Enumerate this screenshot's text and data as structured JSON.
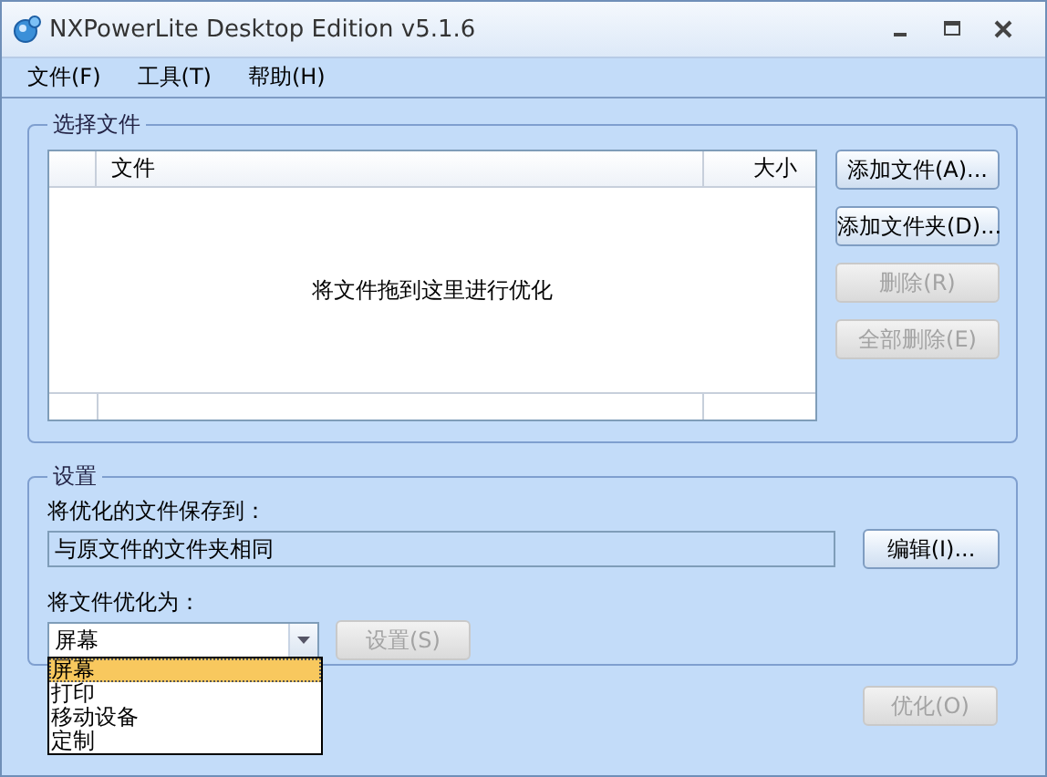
{
  "window": {
    "title": "NXPowerLite Desktop Edition v5.1.6"
  },
  "menu": [
    {
      "label": "文件(F)"
    },
    {
      "label": "工具(T)"
    },
    {
      "label": "帮助(H)"
    }
  ],
  "file_group": {
    "title": "选择文件",
    "table": {
      "columns": [
        "文件",
        "大小"
      ],
      "empty_message": "将文件拖到这里进行优化"
    },
    "buttons": [
      {
        "label": "添加文件(A)...",
        "disabled": false
      },
      {
        "label": "添加文件夹(D)...",
        "disabled": false
      },
      {
        "label": "删除(R)",
        "disabled": true
      },
      {
        "label": "全部删除(E)",
        "disabled": true
      }
    ]
  },
  "settings_group": {
    "title": "设置",
    "save_label": "将优化的文件保存到：",
    "save_field": {
      "value": "与原文件的文件夹相同"
    },
    "edit_button": {
      "label": "编辑(I)...",
      "disabled": false
    },
    "optimize_label": "将文件优化为：",
    "profile_dropdown": {
      "value": "屏幕",
      "expanded": true,
      "options": [
        {
          "label": "屏幕",
          "selected": true
        },
        {
          "label": "打印",
          "selected": false
        },
        {
          "label": "移动设备",
          "selected": false
        },
        {
          "label": "定制",
          "selected": false
        }
      ]
    },
    "settings_button": {
      "label": "设置(S)",
      "disabled": true
    }
  },
  "optimize_button": {
    "label": "优化(O)",
    "disabled": true
  }
}
